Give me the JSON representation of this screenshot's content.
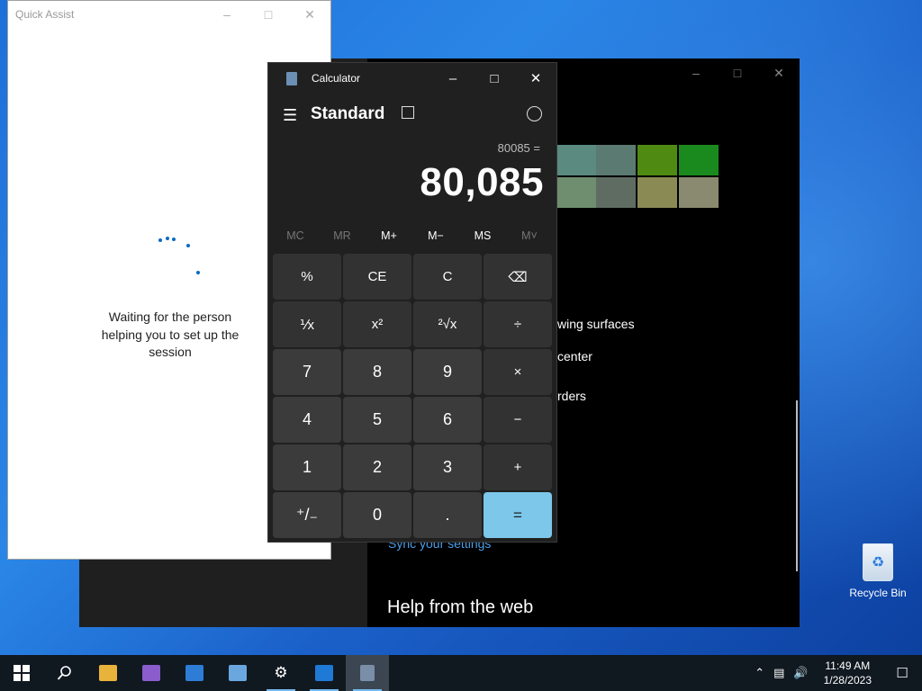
{
  "settings": {
    "partial_lines": [
      "wing surfaces",
      "center",
      "rders"
    ],
    "sync_link": "Sync your settings",
    "help_heading": "Help from the web",
    "swatch_colors": [
      "#5a8a80",
      "#5b7a72",
      "#4f8a12",
      "#1b8a1e",
      "#6f8e70",
      "#5f6c62",
      "#8a8a55",
      "#8a8a70"
    ]
  },
  "quick_assist": {
    "title": "Quick Assist",
    "message": "Waiting for the person helping you to set up the session"
  },
  "calculator": {
    "title": "Calculator",
    "mode": "Standard",
    "expression": "80085 =",
    "display": "80,085",
    "memory_buttons": [
      {
        "label": "MC",
        "enabled": false
      },
      {
        "label": "MR",
        "enabled": false
      },
      {
        "label": "M+",
        "enabled": true
      },
      {
        "label": "M−",
        "enabled": true
      },
      {
        "label": "MS",
        "enabled": true
      },
      {
        "label": "M˅",
        "enabled": false
      }
    ],
    "keys": [
      {
        "label": "%",
        "kind": "fn",
        "name": "percent-key"
      },
      {
        "label": "CE",
        "kind": "fn",
        "name": "clear-entry-key"
      },
      {
        "label": "C",
        "kind": "fn",
        "name": "clear-key"
      },
      {
        "label": "⌫",
        "kind": "fn",
        "name": "backspace-key"
      },
      {
        "label": "⅟x",
        "kind": "fn",
        "name": "reciprocal-key"
      },
      {
        "label": "x²",
        "kind": "fn",
        "name": "square-key"
      },
      {
        "label": "²√x",
        "kind": "fn",
        "name": "square-root-key"
      },
      {
        "label": "÷",
        "kind": "fn",
        "name": "divide-key"
      },
      {
        "label": "7",
        "kind": "num",
        "name": "digit-7-key"
      },
      {
        "label": "8",
        "kind": "num",
        "name": "digit-8-key"
      },
      {
        "label": "9",
        "kind": "num",
        "name": "digit-9-key"
      },
      {
        "label": "×",
        "kind": "fn",
        "name": "multiply-key"
      },
      {
        "label": "4",
        "kind": "num",
        "name": "digit-4-key"
      },
      {
        "label": "5",
        "kind": "num",
        "name": "digit-5-key"
      },
      {
        "label": "6",
        "kind": "num",
        "name": "digit-6-key"
      },
      {
        "label": "−",
        "kind": "fn",
        "name": "subtract-key"
      },
      {
        "label": "1",
        "kind": "num",
        "name": "digit-1-key"
      },
      {
        "label": "2",
        "kind": "num",
        "name": "digit-2-key"
      },
      {
        "label": "3",
        "kind": "num",
        "name": "digit-3-key"
      },
      {
        "label": "+",
        "kind": "fn",
        "name": "add-key"
      },
      {
        "label": "⁺/₋",
        "kind": "num",
        "name": "negate-key"
      },
      {
        "label": "0",
        "kind": "num",
        "name": "digit-0-key"
      },
      {
        "label": ".",
        "kind": "num",
        "name": "decimal-key"
      },
      {
        "label": "=",
        "kind": "eq",
        "name": "equals-key"
      }
    ]
  },
  "desktop": {
    "recycle_bin_label": "Recycle Bin"
  },
  "taskbar": {
    "clock_time": "11:49 AM",
    "clock_date": "1/28/2023"
  }
}
